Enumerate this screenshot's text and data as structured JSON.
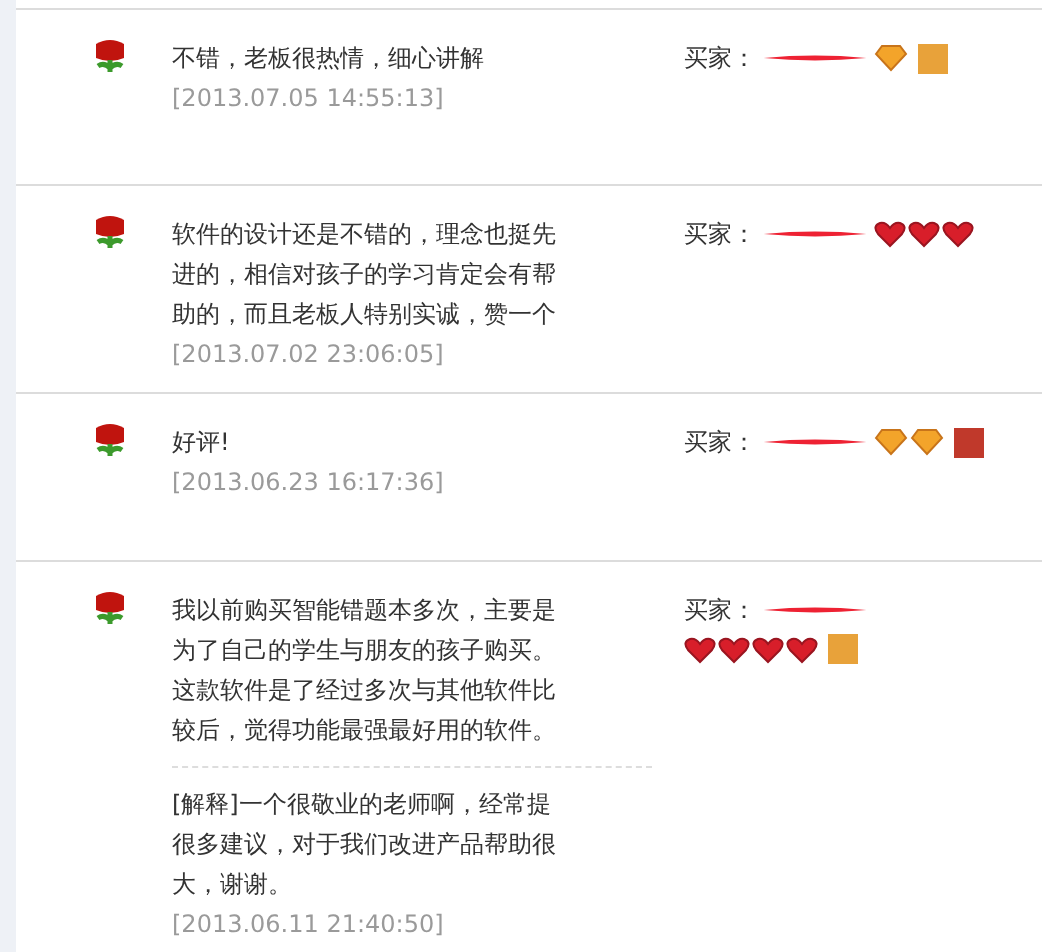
{
  "reviews": [
    {
      "text": "不错，老板很热情，细心讲解",
      "date": "[2013.07.05 14:55:13]",
      "buyer_label": "买家：",
      "rank_icons": [
        {
          "kind": "diamond"
        }
      ],
      "badge": {
        "color": "#e8a23a"
      }
    },
    {
      "text": "软件的设计还是不错的，理念也挺先进的，相信对孩子的学习肯定会有帮助的，而且老板人特别实诚，赞一个",
      "date": "[2013.07.02 23:06:05]",
      "buyer_label": "买家：",
      "rank_icons": [
        {
          "kind": "heart"
        },
        {
          "kind": "heart"
        },
        {
          "kind": "heart"
        }
      ]
    },
    {
      "text": "好评!",
      "date": "[2013.06.23 16:17:36]",
      "buyer_label": "买家：",
      "rank_icons": [
        {
          "kind": "diamond"
        },
        {
          "kind": "diamond"
        }
      ],
      "badge": {
        "color": "#c0392b"
      }
    },
    {
      "text": "我以前购买智能错题本多次，主要是为了自己的学生与朋友的孩子购买。这款软件是了经过多次与其他软件比较后，觉得功能最强最好用的软件。",
      "reply": "[解释]一个很敬业的老师啊，经常提很多建议，对于我们改进产品帮助很大，谢谢。",
      "date": "[2013.06.11 21:40:50]",
      "buyer_label": "买家：",
      "rank_icons": [
        {
          "kind": "heart"
        },
        {
          "kind": "heart"
        },
        {
          "kind": "heart"
        },
        {
          "kind": "heart"
        }
      ],
      "badge": {
        "color": "#e8a23a"
      }
    }
  ]
}
